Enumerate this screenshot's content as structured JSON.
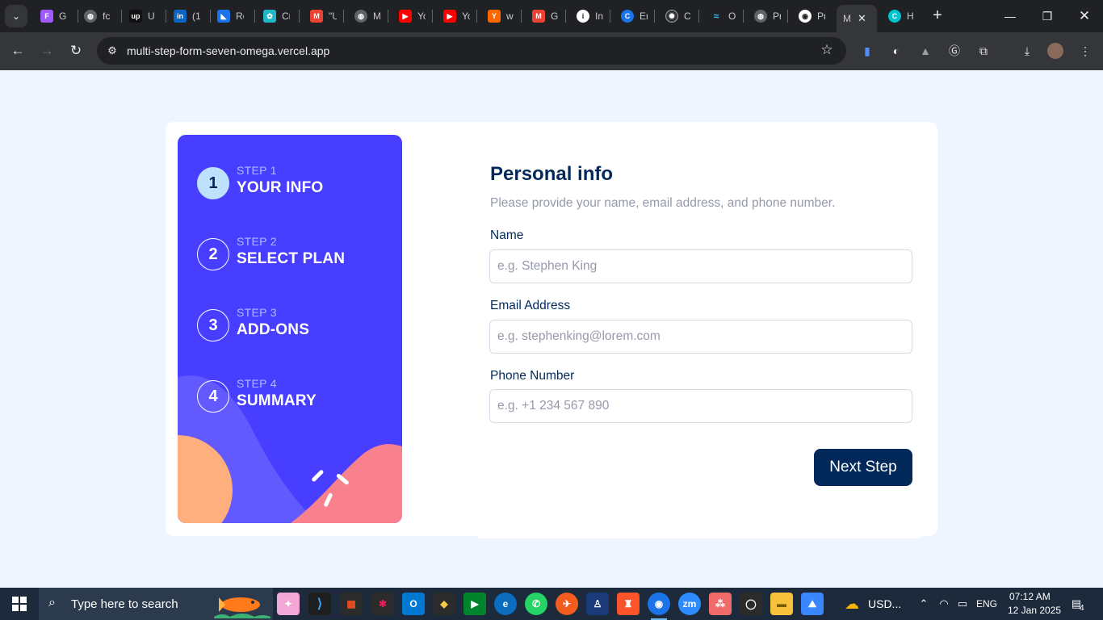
{
  "browser": {
    "tabs": [
      {
        "title": "G",
        "icon": "figma-icon",
        "color": "#a259ff"
      },
      {
        "title": "fc",
        "icon": "globe-icon",
        "color": "#5f6368"
      },
      {
        "title": "U",
        "icon": "upwork-icon",
        "color": "#111111"
      },
      {
        "title": "(1",
        "icon": "linkedin-icon",
        "color": "#0a66c2"
      },
      {
        "title": "Re",
        "icon": "bookmark-icon",
        "color": "#1a73e8"
      },
      {
        "title": "Cr",
        "icon": "cube-icon",
        "color": "#20b8c9"
      },
      {
        "title": "\"U",
        "icon": "gmail-icon",
        "color": "#ea4335"
      },
      {
        "title": "M",
        "icon": "globe-icon",
        "color": "#5f6368"
      },
      {
        "title": "Yo",
        "icon": "youtube-icon",
        "color": "#ff0000"
      },
      {
        "title": "Yo",
        "icon": "youtube-icon",
        "color": "#ff0000"
      },
      {
        "title": "w",
        "icon": "ycombinator-icon",
        "color": "#ff6600"
      },
      {
        "title": "G",
        "icon": "gmail-icon",
        "color": "#ea4335"
      },
      {
        "title": "In",
        "icon": "info-icon",
        "color": "#ffffff"
      },
      {
        "title": "Er",
        "icon": "edge-icon",
        "color": "#1a73e8"
      },
      {
        "title": "C",
        "icon": "openai-icon",
        "color": "#9aa0a6"
      },
      {
        "title": "O",
        "icon": "tailwind-icon",
        "color": "#38bdf8"
      },
      {
        "title": "Pr",
        "icon": "globe-icon",
        "color": "#5f6368"
      },
      {
        "title": "Pr",
        "icon": "github-icon",
        "color": "#ffffff"
      },
      {
        "title": "M",
        "icon": "frontend-mentor-icon",
        "color": "#35363a"
      },
      {
        "title": "H",
        "icon": "canva-icon",
        "color": "#00c4cc"
      }
    ],
    "url": "multi-step-form-seven-omega.vercel.app"
  },
  "sidebar": {
    "steps": [
      {
        "number": "1",
        "label": "STEP 1",
        "title": "YOUR INFO",
        "active": true
      },
      {
        "number": "2",
        "label": "STEP 2",
        "title": "SELECT PLAN",
        "active": false
      },
      {
        "number": "3",
        "label": "STEP 3",
        "title": "ADD-ONS",
        "active": false
      },
      {
        "number": "4",
        "label": "STEP 4",
        "title": "SUMMARY",
        "active": false
      }
    ]
  },
  "form": {
    "title": "Personal info",
    "description": "Please provide your name, email address, and phone number.",
    "fields": {
      "name": {
        "label": "Name",
        "placeholder": "e.g. Stephen King",
        "value": ""
      },
      "email": {
        "label": "Email Address",
        "placeholder": "e.g. stephenking@lorem.com",
        "value": ""
      },
      "phone": {
        "label": "Phone Number",
        "placeholder": "e.g. +1 234 567 890",
        "value": ""
      }
    },
    "next_label": "Next Step"
  },
  "colors": {
    "sidebar_bg": "#483eff",
    "primary_text": "#022959",
    "active_step": "#bee2fd",
    "page_bg": "#eff5ff"
  },
  "taskbar": {
    "search_placeholder": "Type here to search",
    "weather": "USD...",
    "language": "ENG",
    "time": "07:12 AM",
    "date": "12 Jan 2025",
    "notifications": "4"
  }
}
